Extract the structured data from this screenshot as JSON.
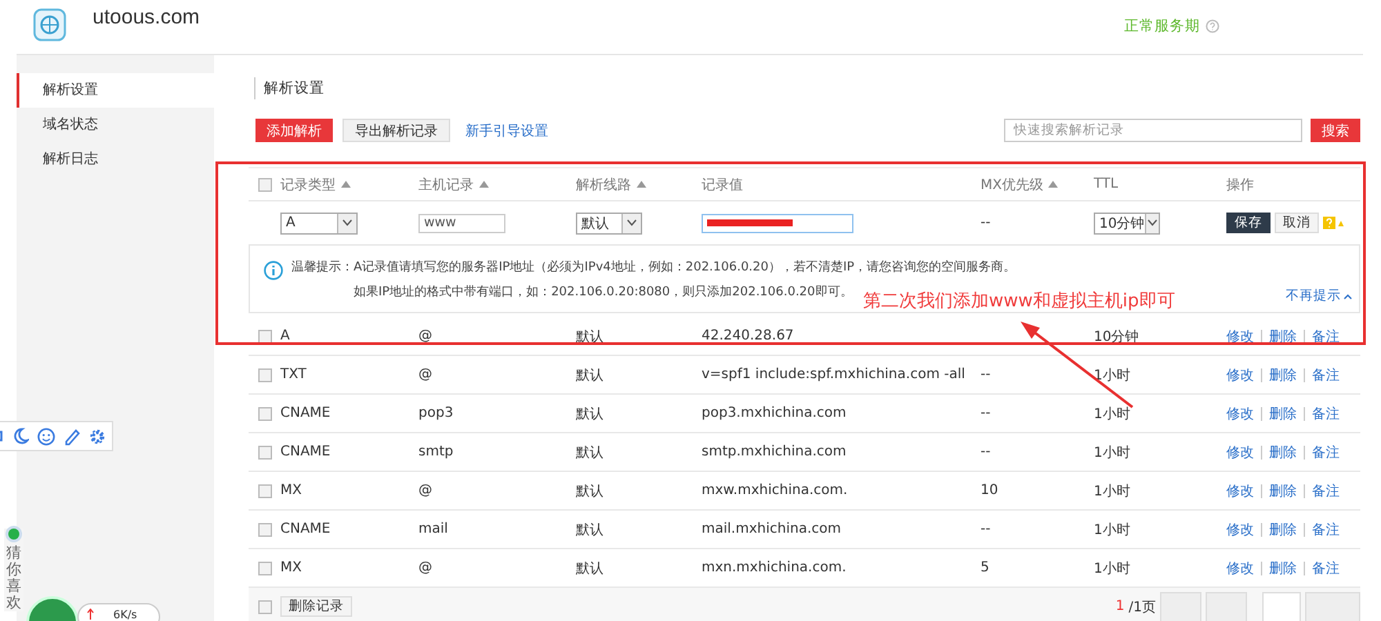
{
  "header": {
    "domain": "utoous.com",
    "status": "正常服务期"
  },
  "sidebar": {
    "items": [
      {
        "label": "解析设置",
        "selected": true
      },
      {
        "label": "域名状态",
        "selected": false
      },
      {
        "label": "解析日志",
        "selected": false
      }
    ]
  },
  "page_title": "解析设置",
  "toolbar": {
    "add_button": "添加解析",
    "export_button": "导出解析记录",
    "guide_link": "新手引导设置",
    "search": {
      "placeholder": "快速搜索解析记录"
    },
    "search_button": "搜索"
  },
  "table": {
    "all_checked": false,
    "columns": [
      {
        "label": "记录类型",
        "sortable": true
      },
      {
        "label": "主机记录",
        "sortable": true
      },
      {
        "label": "解析线路",
        "sortable": true
      },
      {
        "label": "记录值",
        "sortable": false
      },
      {
        "label": "MX优先级",
        "sortable": true
      },
      {
        "label": "TTL",
        "sortable": false
      },
      {
        "label": "操作",
        "sortable": false
      }
    ],
    "edit_row": {
      "type": "A",
      "host": "www",
      "line": "默认",
      "mx": "--",
      "ttl": "10分钟",
      "save": "保存",
      "cancel": "取消"
    },
    "tip": {
      "lines": [
        "温馨提示：A记录值请填写您的服务器IP地址（必须为IPv4地址，例如：202.106.0.20），若不清楚IP，请您咨询您的空间服务商。",
        "如果IP地址的格式中带有端口，如：202.106.0.20:8080，则只添加202.106.0.20即可。"
      ],
      "dismiss": "不再提示"
    },
    "rows": [
      {
        "checked": false,
        "type": "A",
        "host": "@",
        "line": "默认",
        "value": "42.240.28.67",
        "mx": "",
        "ttl": "10分钟",
        "actions": [
          "修改",
          "删除",
          "备注"
        ]
      },
      {
        "checked": false,
        "type": "TXT",
        "host": "@",
        "line": "默认",
        "value": "v=spf1 include:spf.mxhichina.com -all",
        "mx": "--",
        "ttl": "1小时",
        "actions": [
          "修改",
          "删除",
          "备注"
        ]
      },
      {
        "checked": false,
        "type": "CNAME",
        "host": "pop3",
        "line": "默认",
        "value": "pop3.mxhichina.com",
        "mx": "--",
        "ttl": "1小时",
        "actions": [
          "修改",
          "删除",
          "备注"
        ]
      },
      {
        "checked": false,
        "type": "CNAME",
        "host": "smtp",
        "line": "默认",
        "value": "smtp.mxhichina.com",
        "mx": "--",
        "ttl": "1小时",
        "actions": [
          "修改",
          "删除",
          "备注"
        ]
      },
      {
        "checked": false,
        "type": "MX",
        "host": "@",
        "line": "默认",
        "value": "mxw.mxhichina.com.",
        "mx": "10",
        "ttl": "1小时",
        "actions": [
          "修改",
          "删除",
          "备注"
        ]
      },
      {
        "checked": false,
        "type": "CNAME",
        "host": "mail",
        "line": "默认",
        "value": "mail.mxhichina.com",
        "mx": "--",
        "ttl": "1小时",
        "actions": [
          "修改",
          "删除",
          "备注"
        ]
      },
      {
        "checked": false,
        "type": "MX",
        "host": "@",
        "line": "默认",
        "value": "mxn.mxhichina.com.",
        "mx": "5",
        "ttl": "1小时",
        "actions": [
          "修改",
          "删除",
          "备注"
        ]
      }
    ],
    "footer": {
      "checked": false,
      "delete_button": "删除记录",
      "page_current": "1",
      "page_total": "/1页"
    }
  },
  "annotation": {
    "text": "第二次我们添加www和虚拟主机ip即可"
  },
  "float_widget": {
    "label": "猜你喜欢",
    "speed": "6K/s"
  }
}
